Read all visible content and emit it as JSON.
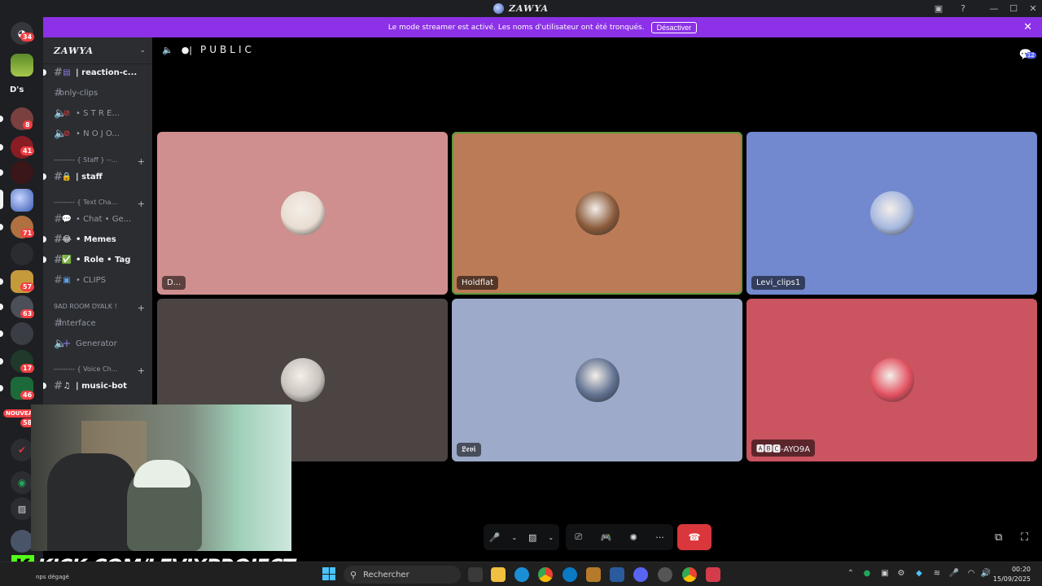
{
  "window": {
    "title": "ZAWYA",
    "controls": {
      "inbox": "▣",
      "help": "?",
      "minimize": "—",
      "maximize": "☐",
      "close": "✕"
    }
  },
  "banner": {
    "text": "Le mode streamer est activé. Les noms d'utilisateur ont été tronqués.",
    "button": "Désactiver",
    "close": "✕"
  },
  "rail": {
    "dm_label": "D's",
    "badges": [
      "34",
      "8",
      "41",
      "71",
      "57",
      "63",
      "17",
      "46",
      "58"
    ],
    "new_label": "NOUVEA"
  },
  "sidebar": {
    "guild_name": "ZAWYA",
    "guild_chevron": "⌄",
    "channels": [
      {
        "icon": "▤",
        "name": "| reaction-c...",
        "bright": true,
        "kind": "text"
      },
      {
        "icon": "",
        "name": "only-clips",
        "bright": false,
        "kind": "text"
      },
      {
        "icon": "⊘",
        "name": "• S T R E...",
        "bright": false,
        "kind": "voice"
      },
      {
        "icon": "⊘",
        "name": "• N O  J O...",
        "bright": false,
        "kind": "voice"
      }
    ],
    "cat_staff": "--------- { Staff } --...",
    "staff_channel": {
      "icon": "🔒",
      "name": "| staff"
    },
    "cat_text": "--------- { Text Cha...",
    "text_channels": [
      {
        "icon": "💬",
        "name": "• Chat • Ge...",
        "bright": false
      },
      {
        "icon": "😂",
        "name": "• Memes",
        "bright": true
      },
      {
        "icon": "✅",
        "name": "• Role • Tag",
        "bright": true
      },
      {
        "icon": "▣",
        "name": "• CLIPS",
        "bright": false
      }
    ],
    "cat_room": "9AD ROOM DYALK !",
    "room_channels": [
      {
        "name": "interface",
        "kind": "text"
      },
      {
        "icon": "+",
        "name": "Generator",
        "kind": "voice"
      }
    ],
    "cat_voice": "--------- { Voice Ch...",
    "music_channel": {
      "icon": "♫",
      "name": "| music-bot"
    },
    "add": "+"
  },
  "call": {
    "channel_name": "PUBLIC",
    "activity_count": "12",
    "participants": [
      {
        "name": "D...",
        "tile_color": "#cf8f8e",
        "avatar_color": "#e8ddd2",
        "speaking": false
      },
      {
        "name": "Holdflat",
        "tile_color": "#bc7b57",
        "avatar_color": "#8a5a3a",
        "speaking": true
      },
      {
        "name": "Levi_clips1",
        "tile_color": "#7289d0",
        "avatar_color": "#a6b8e0",
        "speaking": false
      },
      {
        "name": "",
        "tile_color": "#4b4443",
        "avatar_color": "#c9c3bd",
        "speaking": false
      },
      {
        "name": "𝕷𝖊𝖛𝖎",
        "tile_color": "#9daac9",
        "avatar_color": "#5f7090",
        "speaking": false
      },
      {
        "name": "🅰🅱🅲-AYO9A",
        "tile_color": "#cb5461",
        "avatar_color": "#e25060",
        "speaking": false
      }
    ],
    "controls": {
      "mic": "🎤",
      "camera": "▨",
      "screenshare": "⎚",
      "activity": "🎮",
      "soundboard": "✺",
      "more": "···",
      "hangup": "☎",
      "popout": "⧉",
      "fullscreen": "⛶"
    }
  },
  "overlay": {
    "kick_letter": "K",
    "kick_url": "KICK.COM/LEVIXPROJECT",
    "corner_text": "nps dégagé"
  },
  "taskbar": {
    "search_placeholder": "Rechercher",
    "time": "00:20",
    "date": "15/09/2025"
  }
}
